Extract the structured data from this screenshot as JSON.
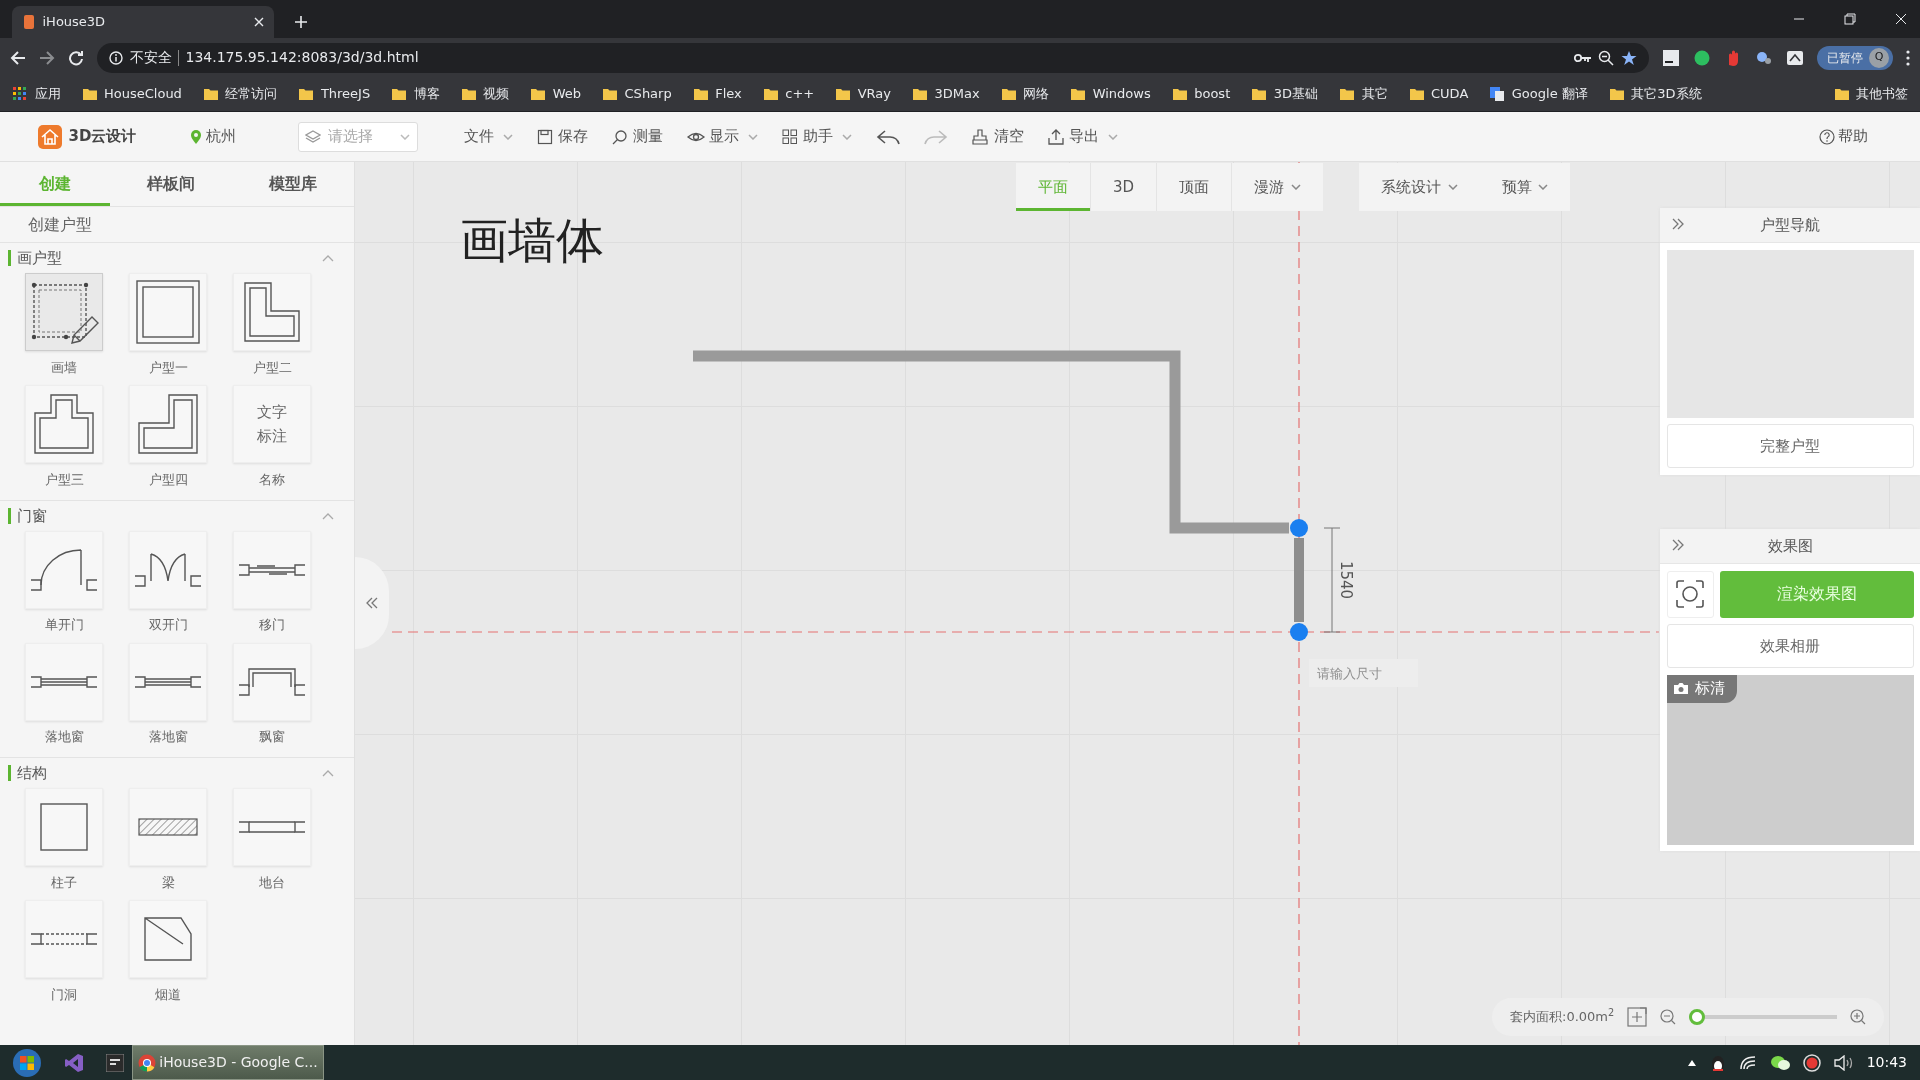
{
  "browser": {
    "tab": {
      "title": "iHouse3D"
    },
    "address": {
      "security": "不安全",
      "url": "134.175.95.142:8083/3d/3d.html"
    },
    "profile": {
      "status": "已暂停",
      "initial": "Q"
    },
    "bookmarks": [
      {
        "label": "应用",
        "kind": "apps"
      },
      {
        "label": "HouseCloud",
        "kind": "folder"
      },
      {
        "label": "经常访问",
        "kind": "folder"
      },
      {
        "label": "ThreeJS",
        "kind": "folder"
      },
      {
        "label": "博客",
        "kind": "folder"
      },
      {
        "label": "视频",
        "kind": "folder"
      },
      {
        "label": "Web",
        "kind": "folder"
      },
      {
        "label": "CSharp",
        "kind": "folder"
      },
      {
        "label": "Flex",
        "kind": "folder"
      },
      {
        "label": "c++",
        "kind": "folder"
      },
      {
        "label": "VRay",
        "kind": "folder"
      },
      {
        "label": "3DMax",
        "kind": "folder"
      },
      {
        "label": "网络",
        "kind": "folder"
      },
      {
        "label": "Windows",
        "kind": "folder"
      },
      {
        "label": "boost",
        "kind": "folder"
      },
      {
        "label": "3D基础",
        "kind": "folder"
      },
      {
        "label": "其它",
        "kind": "folder"
      },
      {
        "label": "CUDA",
        "kind": "folder"
      },
      {
        "label": "Google 翻译",
        "kind": "page"
      },
      {
        "label": "其它3D系统",
        "kind": "folder"
      }
    ],
    "other_bookmarks": {
      "label": "其他书签"
    }
  },
  "app": {
    "brand": "3D云设计",
    "city": "杭州",
    "layer_select": {
      "placeholder": "请选择"
    },
    "menu": [
      {
        "label": "文件",
        "kind": "text",
        "caret": true,
        "disabled": false
      },
      {
        "label": "保存",
        "kind": "save",
        "caret": false,
        "disabled": false
      },
      {
        "label": "测量",
        "kind": "measure",
        "caret": false,
        "disabled": false
      },
      {
        "label": "显示",
        "kind": "view",
        "caret": true,
        "disabled": false
      },
      {
        "label": "助手",
        "kind": "assist",
        "caret": true,
        "disabled": false
      },
      {
        "kind": "undo",
        "disabled": false
      },
      {
        "kind": "redo",
        "disabled": true
      },
      {
        "label": "清空",
        "kind": "clear",
        "caret": false,
        "disabled": false
      },
      {
        "label": "导出",
        "kind": "export",
        "caret": true,
        "disabled": false
      }
    ],
    "help": "帮助"
  },
  "sidebar": {
    "tabs": [
      {
        "label": "创建",
        "selected": true
      },
      {
        "label": "样板间",
        "selected": false
      },
      {
        "label": "模型库",
        "selected": false
      }
    ],
    "heading": "创建户型",
    "sections": [
      {
        "title": "画户型",
        "expanded": true,
        "items": [
          {
            "label": "画墙",
            "kind": "wall",
            "selected": true
          },
          {
            "label": "户型一",
            "kind": "square",
            "selected": false
          },
          {
            "label": "户型二",
            "kind": "lshape",
            "selected": false
          },
          {
            "label": "户型三",
            "kind": "tshape",
            "selected": false
          },
          {
            "label": "户型四",
            "kind": "notch",
            "selected": false
          },
          {
            "label": "名称",
            "kind": "text",
            "text": "文字标注",
            "selected": false
          }
        ]
      },
      {
        "title": "门窗",
        "expanded": true,
        "items": [
          {
            "label": "单开门",
            "kind": "swing",
            "selected": false
          },
          {
            "label": "双开门",
            "kind": "double",
            "selected": false
          },
          {
            "label": "移门",
            "kind": "sliding",
            "selected": false
          },
          {
            "label": "落地窗",
            "kind": "window",
            "selected": false
          },
          {
            "label": "落地窗",
            "kind": "window",
            "selected": false
          },
          {
            "label": "飘窗",
            "kind": "bay",
            "selected": false
          }
        ]
      },
      {
        "title": "结构",
        "expanded": true,
        "items": [
          {
            "label": "柱子",
            "kind": "column",
            "selected": false
          },
          {
            "label": "梁",
            "kind": "beam",
            "selected": false
          },
          {
            "label": "地台",
            "kind": "platform",
            "selected": false
          },
          {
            "label": "门洞",
            "kind": "opening",
            "selected": false
          },
          {
            "label": "烟道",
            "kind": "flue",
            "selected": false
          }
        ]
      }
    ]
  },
  "canvas": {
    "title": "画墙体",
    "view_tabs": [
      {
        "label": "平面",
        "selected": true,
        "caret": false
      },
      {
        "label": "3D",
        "selected": false,
        "caret": false
      },
      {
        "label": "顶面",
        "selected": false,
        "caret": false
      },
      {
        "label": "漫游",
        "selected": false,
        "caret": true
      }
    ],
    "view_menus": [
      {
        "label": "系统设计"
      },
      {
        "label": "预算"
      }
    ],
    "dimension": "1540",
    "size_input": {
      "placeholder": "请输入尺寸"
    },
    "area": "套内面积:0.00m$^{2}$",
    "zoom": {
      "level": 0
    }
  },
  "panels": {
    "navigator": {
      "title": "户型导航",
      "button": "完整户型"
    },
    "render": {
      "title": "效果图",
      "render_button": "渲染效果图",
      "album_button": "效果相册",
      "quality_badge": "标清"
    }
  },
  "taskbar": {
    "windows": [
      {
        "label": "iHouse3D - Google C...",
        "selected": true
      }
    ],
    "clock": "10:43"
  }
}
